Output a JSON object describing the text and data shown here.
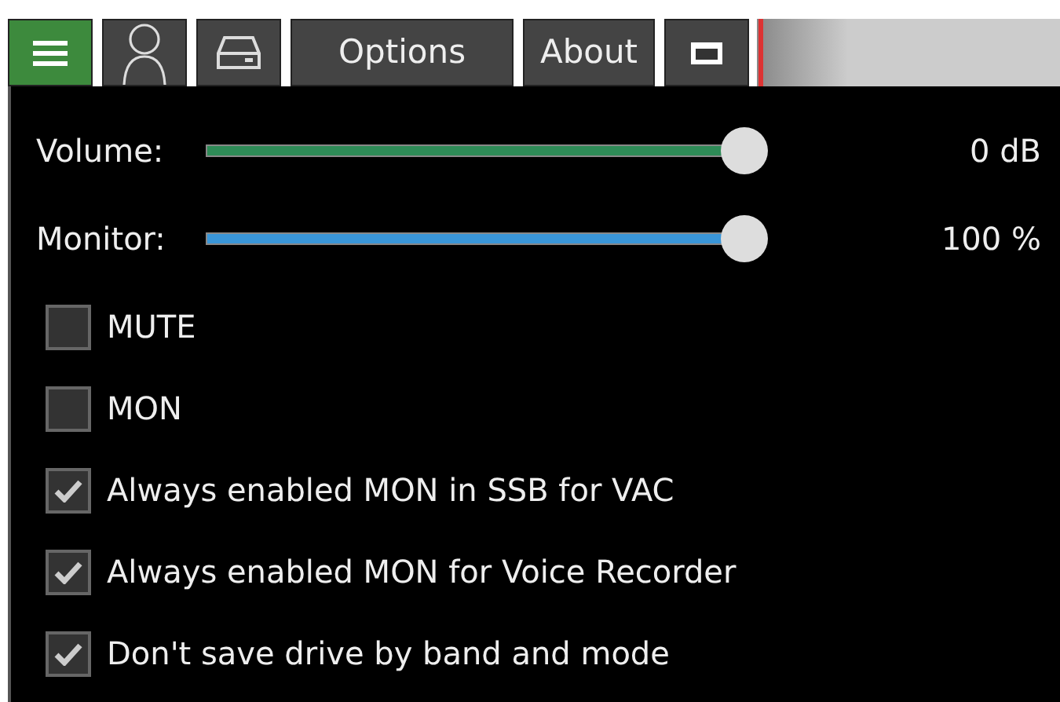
{
  "toolbar": [
    {
      "kind": "menu",
      "selected": true
    },
    {
      "kind": "person",
      "selected": false
    },
    {
      "kind": "drive",
      "selected": false
    },
    {
      "kind": "text",
      "label": "Options",
      "selected": false
    },
    {
      "kind": "text",
      "label": "About",
      "selected": false
    },
    {
      "kind": "window",
      "selected": false
    }
  ],
  "sliders": [
    {
      "label": "Volume:",
      "level": 1,
      "color": "#2e8b57",
      "reading": "0 dB"
    },
    {
      "label": "Monitor:",
      "level": 1,
      "color": "#3a96d8",
      "reading": "100 %"
    }
  ],
  "checkboxes": [
    {
      "label": "MUTE",
      "checked": false
    },
    {
      "label": "MON",
      "checked": false
    },
    {
      "label": "Always enabled MON in SSB for VAC",
      "checked": true
    },
    {
      "label": "Always enabled MON for Voice Recorder",
      "checked": true
    },
    {
      "label": "Don't save drive by band and mode",
      "checked": true
    }
  ]
}
